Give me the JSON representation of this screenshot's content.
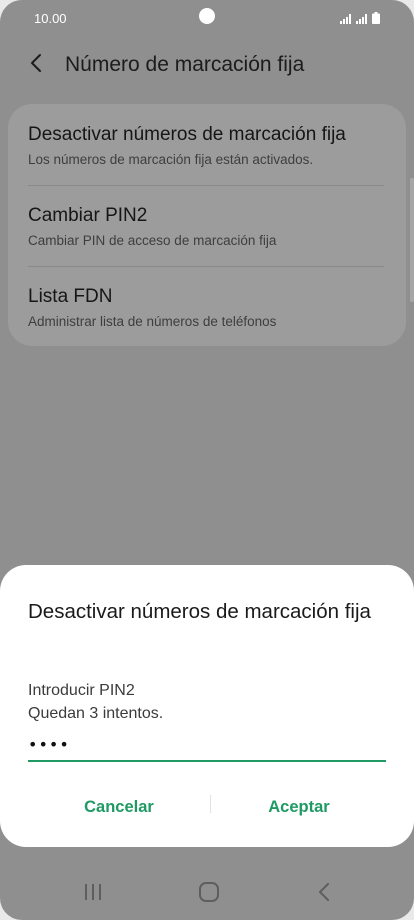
{
  "status_bar": {
    "time": "10.00"
  },
  "header": {
    "title": "Número de marcación fija"
  },
  "settings": {
    "items": [
      {
        "title": "Desactivar números de marcación fija",
        "subtitle": "Los números de marcación fija están activados."
      },
      {
        "title": "Cambiar PIN2",
        "subtitle": "Cambiar PIN de acceso de marcación fija"
      },
      {
        "title": "Lista FDN",
        "subtitle": "Administrar lista de números de teléfonos"
      }
    ]
  },
  "dialog": {
    "title": "Desactivar números de marcación fija",
    "message_line1": "Introducir PIN2",
    "message_line2": "Quedan 3 intentos.",
    "pin_value": "••••",
    "cancel_label": "Cancelar",
    "accept_label": "Aceptar"
  },
  "colors": {
    "accent": "#1f9a63",
    "scrim": "#8f8f8f",
    "dialog_bg": "#ffffff"
  },
  "icons": {
    "back": "back-arrow-icon",
    "signal": "signal-icon",
    "battery": "battery-icon",
    "recents": "recents-icon",
    "home": "home-icon",
    "nav_back": "nav-back-icon"
  }
}
